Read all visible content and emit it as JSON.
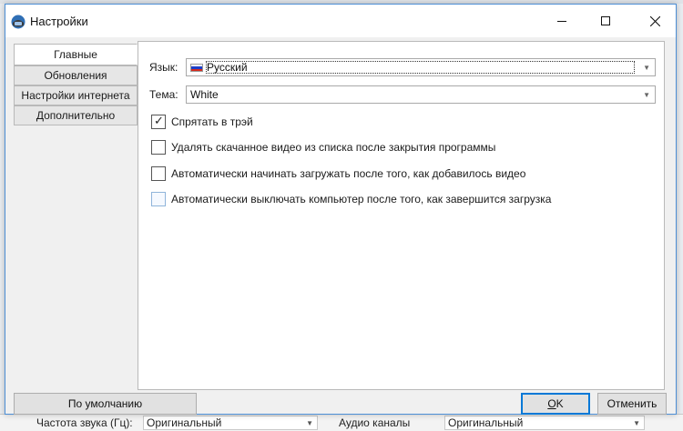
{
  "window": {
    "title": "Настройки"
  },
  "tabs": [
    {
      "label": "Главные",
      "active": true
    },
    {
      "label": "Обновления",
      "active": false
    },
    {
      "label": "Настройки интернета",
      "active": false
    },
    {
      "label": "Дополнительно",
      "active": false
    }
  ],
  "language": {
    "label": "Язык:",
    "value": "Русский"
  },
  "theme": {
    "label": "Тема:",
    "value": "White"
  },
  "checkboxes": [
    {
      "label": "Спрятать в трэй",
      "checked": true
    },
    {
      "label": "Удалять скачанное видео из списка после закрытия программы",
      "checked": false
    },
    {
      "label": "Автоматически начинать загружать после того, как добавилось видео",
      "checked": false
    },
    {
      "label": "Автоматически выключать компьютер после того, как завершится загрузка",
      "checked": false
    }
  ],
  "buttons": {
    "default_label": "По умолчанию",
    "ok_mnemonic": "O",
    "ok_rest": "K",
    "cancel_label": "Отменить"
  },
  "background": {
    "freq_label": "Частота звука (Гц):",
    "freq_value": "Оригинальный",
    "channels_label": "Аудио каналы",
    "channels_value": "Оригинальный"
  },
  "colors": {
    "accent": "#0078d7",
    "frame": "#4d8fd6",
    "flag_white": "#ffffff",
    "flag_blue": "#1c3fc9",
    "flag_red": "#d52b1e"
  }
}
